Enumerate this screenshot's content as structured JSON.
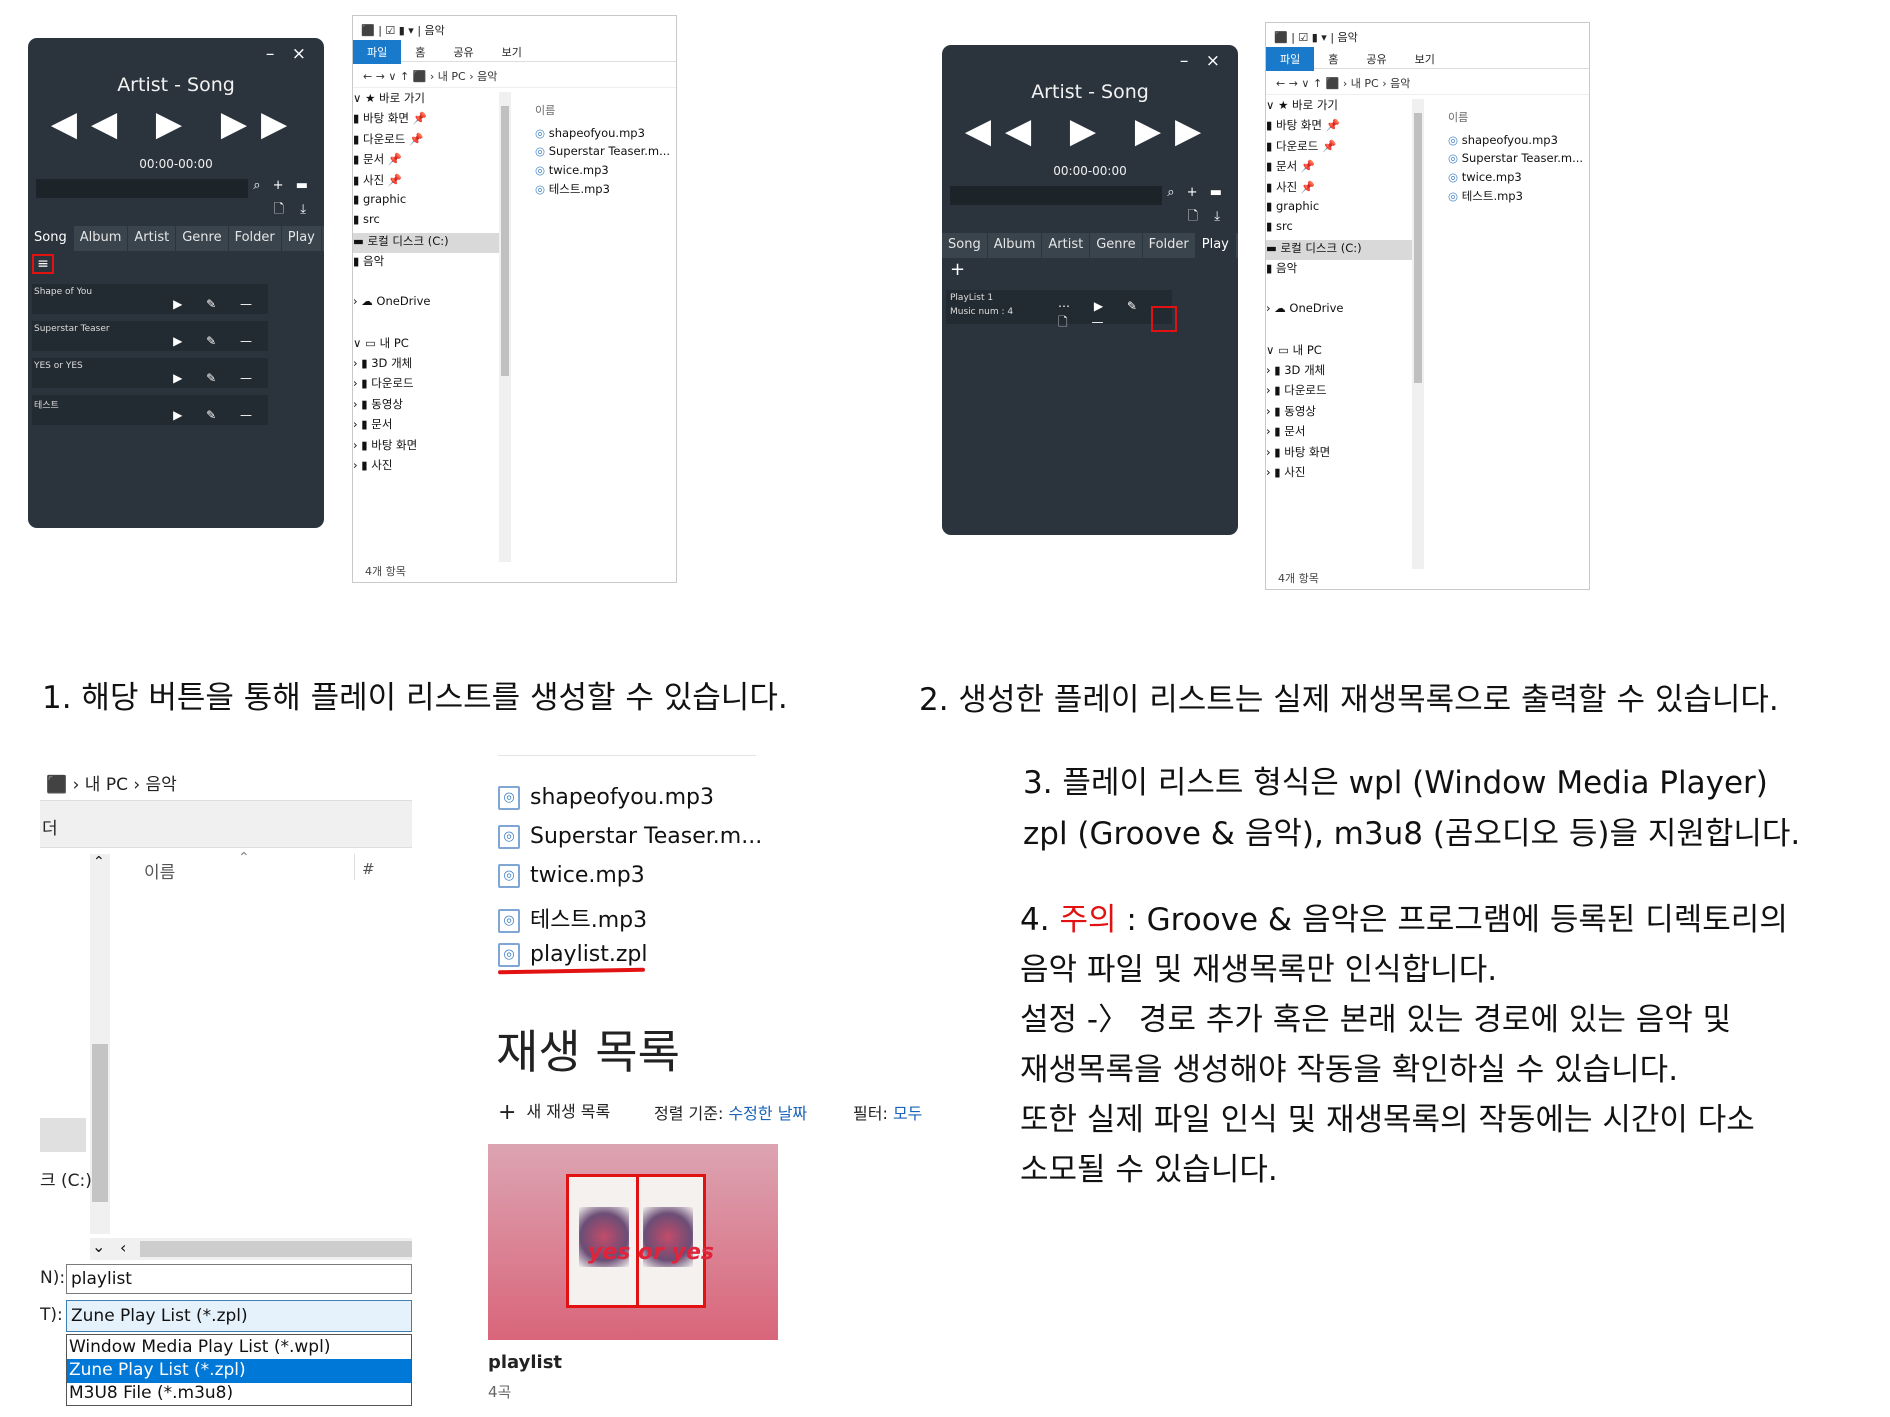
{
  "player": {
    "title": "Artist - Song",
    "time": "00:00-00:00",
    "window_buttons": "– ×",
    "controls": "◀◀ ▶ ▶▶",
    "search_icons": "⌕ + ▬",
    "file_icons": "🗋 ⤓",
    "tabs": [
      "Song",
      "Album",
      "Artist",
      "Genre",
      "Folder",
      "Play"
    ],
    "menu_icon": "≡",
    "add_icon": "+",
    "songs": [
      "Shape of You",
      "Superstar Teaser",
      "YES or YES",
      "테스트"
    ],
    "song_actions": "▶ ✎ —",
    "playlist": {
      "name": "PlayList 1",
      "count": "Music num : 4",
      "actions": "⋯ ▶ ✎ 🗋 —"
    }
  },
  "explorer": {
    "titlebar": "⬛ | ☑ ▮ ▾ | 음악",
    "ribbon": [
      "파일",
      "홈",
      "공유",
      "보기"
    ],
    "address": "←  →  ∨  ↑   ⬛ ›  내 PC  ›  음악",
    "nav": [
      "∨  ★ 바로 가기",
      "      ▮ 바탕 화면          📌",
      "      ▮ 다운로드            📌",
      "      ▮ 문서                  📌",
      "      ▮ 사진                  📌",
      "      ▮ graphic",
      "      ▮ src",
      "      ▬ 로컬 디스크 (C:)",
      "      ▮ 음악",
      "",
      "›  ☁ OneDrive",
      "",
      "∨  ▭ 내 PC",
      "   ›  ▮ 3D 개체",
      "   ›  ▮ 다운로드",
      "   ›  ▮ 동영상",
      "   ›  ▮ 문서",
      "   ›  ▮ 바탕 화면",
      "   ›  ▮ 사진"
    ],
    "column": "이름",
    "files": [
      "shapeofyou.mp3",
      "Superstar Teaser.m...",
      "twice.mp3",
      "테스트.mp3"
    ],
    "count": "4개 항목"
  },
  "captions": {
    "c1": "1. 해당 버튼을 통해 플레이 리스트를 생성할 수 있습니다.",
    "c2": "2. 생성한 플레이 리스트는 실제 재생목록으로 출력할 수 있습니다.",
    "c3_l1": "3. 플레이 리스트 형식은 wpl (Window Media Player)",
    "c3_l2": "zpl (Groove & 음악), m3u8 (곰오디오 등)을 지원합니다.",
    "c4_prefix": "4. ",
    "c4_warn": "주의",
    "c4_l1_rest": " : Groove & 음악은 프로그램에 등록된 디렉토리의",
    "c4_l2": "음악 파일 및 재생목록만 인식합니다.",
    "c4_l3": "설정 -〉 경로 추가 혹은 본래 있는 경로에 있는 음악 및",
    "c4_l4": "재생목록을 생성해야 작동을 확인하실 수 있습니다.",
    "c4_l5": "또한 실제 파일 인식 및 재생목록의 작동에는 시간이 다소",
    "c4_l6": "소모될 수 있습니다."
  },
  "save_dialog": {
    "address": "⬛  ›  내 PC  ›  음악",
    "side_label": "더",
    "col_name": "이름",
    "col_hash": "#",
    "drive": "크 (C:)",
    "filename_label": "N):",
    "filename_value": "playlist",
    "type_label": "T):",
    "type_value": "Zune Play List (*.zpl)",
    "options": [
      "Window Media Play List (*.wpl)",
      "Zune Play List (*.zpl)",
      "M3U8 File (*.m3u8)"
    ]
  },
  "groove": {
    "files": [
      "shapeofyou.mp3",
      "Superstar Teaser.m...",
      "twice.mp3",
      "테스트.mp3",
      "playlist.zpl"
    ],
    "heading": "재생 목록",
    "new_playlist": "새 재생 목록",
    "sort_label": "정렬 기준:",
    "sort_value": "수정한 날짜",
    "filter_label": "필터:",
    "filter_value": "모두",
    "album_art_text": "yes or yes",
    "playlist_name": "playlist",
    "playlist_count": "4곡"
  },
  "colors": {
    "player_bg": "#2b343d",
    "highlight": "#e31212",
    "ribbon_blue": "#1979ca",
    "link_blue": "#1a63b8",
    "album_bg": "#d9657a"
  }
}
